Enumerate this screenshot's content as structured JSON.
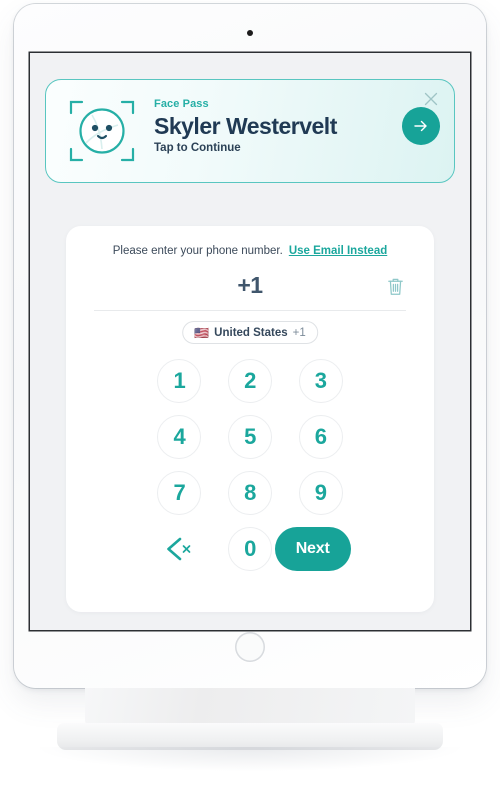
{
  "device": {
    "camera_icon": "camera-dot",
    "home_button_icon": "home-button"
  },
  "colors": {
    "accent_teal": "#17a398",
    "accent_teal_text": "#1ba79d",
    "dark_navy": "#203a54",
    "screen_background": "#f1f2f4",
    "card_background": "#ffffff",
    "banner_border": "#59c6c0",
    "key_border": "#eceef0",
    "muted_text": "#7c8b99"
  },
  "banner": {
    "eyebrow": "Face Pass",
    "name": "Skyler Westervelt",
    "action_hint": "Tap to Continue",
    "face_icon": "face-scan-icon",
    "close_icon": "close-icon",
    "continue_icon": "arrow-right-icon"
  },
  "phone_entry": {
    "prompt": "Please enter your phone number.",
    "alt_link": "Use Email Instead",
    "number_value": "+1",
    "number_placeholder": "+1",
    "clear_icon": "trash-icon",
    "country": {
      "flag": "🇺🇸",
      "name": "United States",
      "dial_code": "+1"
    },
    "keypad": {
      "keys": [
        "1",
        "2",
        "3",
        "4",
        "5",
        "6",
        "7",
        "8",
        "9"
      ],
      "zero": "0",
      "backspace_icon": "backspace-icon",
      "submit_label": "Next"
    }
  }
}
